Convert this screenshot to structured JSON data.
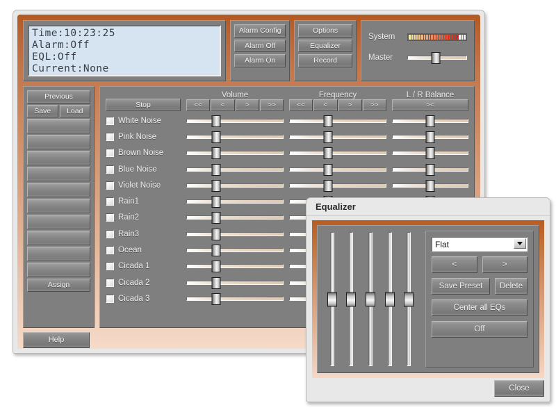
{
  "main_window": {
    "lcd": {
      "lines": [
        "Time:10:23:25",
        "Alarm:Off",
        "EQL:Off",
        "Current:None"
      ]
    },
    "alarm_buttons": [
      {
        "label": "Alarm Config",
        "name": "alarm-config-button"
      },
      {
        "label": "Alarm Off",
        "name": "alarm-off-button"
      },
      {
        "label": "Alarm On",
        "name": "alarm-on-button"
      }
    ],
    "option_buttons": [
      {
        "label": "Options",
        "name": "options-button"
      },
      {
        "label": "Equalizer",
        "name": "equalizer-button"
      },
      {
        "label": "Record",
        "name": "record-button"
      }
    ],
    "levels": {
      "system_label": "System",
      "master_label": "Master",
      "system_meter_lit": 20,
      "system_meter_total": 23,
      "master_value": 48
    },
    "presets": {
      "previous_label": "Previous",
      "save_label": "Save",
      "load_label": "Load",
      "assign_label": "Assign",
      "empty_slots": 10,
      "slot_labels": [
        "",
        "",
        "",
        "",
        "",
        "",
        "",
        "",
        "",
        ""
      ]
    },
    "help_label": "Help",
    "mixer": {
      "stop_label": "Stop",
      "columns": [
        {
          "title": "Volume",
          "name": "volume-column",
          "nudges": [
            "<<",
            "<",
            ">",
            ">>"
          ]
        },
        {
          "title": "Frequency",
          "name": "frequency-column",
          "nudges": [
            "<<",
            "<",
            ">",
            ">>"
          ]
        },
        {
          "title": "L / R Balance",
          "name": "balance-column",
          "nudges": [
            "><"
          ]
        }
      ],
      "sounds": [
        {
          "label": "White Noise",
          "checked": false,
          "volume": 31,
          "frequency": 40,
          "balance": 50
        },
        {
          "label": "Pink Noise",
          "checked": false,
          "volume": 31,
          "frequency": 40,
          "balance": 50
        },
        {
          "label": "Brown Noise",
          "checked": false,
          "volume": 31,
          "frequency": 40,
          "balance": 50
        },
        {
          "label": "Blue Noise",
          "checked": false,
          "volume": 31,
          "frequency": 40,
          "balance": 50
        },
        {
          "label": "Violet Noise",
          "checked": false,
          "volume": 31,
          "frequency": 40,
          "balance": 50
        },
        {
          "label": "Rain1",
          "checked": false,
          "volume": 31,
          "frequency": 40,
          "balance": 50
        },
        {
          "label": "Rain2",
          "checked": false,
          "volume": 31,
          "frequency": 40,
          "balance": 50
        },
        {
          "label": "Rain3",
          "checked": false,
          "volume": 31,
          "frequency": 40,
          "balance": 50
        },
        {
          "label": "Ocean",
          "checked": false,
          "volume": 31,
          "frequency": 40,
          "balance": 50
        },
        {
          "label": "Cicada 1",
          "checked": false,
          "volume": 31,
          "frequency": 40,
          "balance": 50
        },
        {
          "label": "Cicada 2",
          "checked": false,
          "volume": 31,
          "frequency": 40,
          "balance": 50
        },
        {
          "label": "Cicada 3",
          "checked": false,
          "volume": 31,
          "frequency": 40,
          "balance": 50
        }
      ]
    }
  },
  "equalizer_dialog": {
    "title": "Equalizer",
    "preset_value": "Flat",
    "prev_label": "<",
    "next_label": ">",
    "save_preset_label": "Save Preset",
    "delete_label": "Delete",
    "center_label": "Center all EQs",
    "off_label": "Off",
    "close_label": "Close",
    "bands": [
      50,
      50,
      50,
      50,
      50
    ]
  },
  "colors": {
    "frame_orange": "#b85c22",
    "panel_gray": "#7f7f7f",
    "lcd_bg": "#d6e4f2",
    "slider_track": "#e6d4c0",
    "meter_low": "#f5efb0",
    "meter_high": "#e01f10"
  }
}
